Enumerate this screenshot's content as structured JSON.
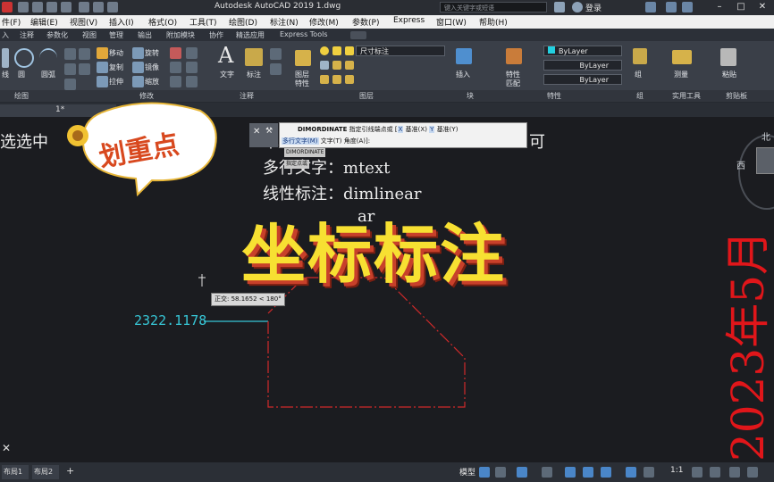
{
  "title_bar": {
    "app_title": "Autodesk AutoCAD 2019    1.dwg",
    "search_placeholder": "键入关键字或短语",
    "login": "登录"
  },
  "menu": [
    "件(F)",
    "编辑(E)",
    "视图(V)",
    "插入(I)",
    "格式(O)",
    "工具(T)",
    "绘图(D)",
    "标注(N)",
    "修改(M)",
    "参数(P)",
    "Express",
    "窗口(W)",
    "帮助(H)"
  ],
  "ribbon_tabs": [
    "入",
    "注释",
    "参数化",
    "视图",
    "管理",
    "输出",
    "附加模块",
    "协作",
    "精选应用",
    "Express Tools"
  ],
  "ribbon": {
    "draw": {
      "line": "线",
      "circle": "圆",
      "arc": "圆弧"
    },
    "modify": {
      "move": "移动",
      "rotate": "旋转",
      "copy": "复制",
      "mirror": "镜像",
      "stretch": "拉伸",
      "scale": "缩放"
    },
    "annotation": {
      "text": "文字",
      "dimension": "标注"
    },
    "layers": {
      "props": "图层",
      "props2": "特性",
      "current_layer": "尺寸标注"
    },
    "block": {
      "insert": "插入"
    },
    "properties": {
      "match": "特性",
      "match2": "匹配",
      "bylayer1": "ByLayer",
      "bylayer2": "ByLayer",
      "bylayer3": "ByLayer"
    },
    "group": {
      "group": "组"
    },
    "utilities": {
      "measure": "测量"
    },
    "clipboard": {
      "paste": "粘贴"
    },
    "panels": [
      "绘图",
      "修改",
      "注释",
      "图层",
      "块",
      "特性",
      "组",
      "实用工具",
      "剪贴板"
    ]
  },
  "doc_tab": "1*",
  "canvas": {
    "left_text": "选选中",
    "line1_prefix": "单",
    "line1_suffix": "可",
    "line2": "多行文字：mtext",
    "line3": "线性标注：dimlinear",
    "line4_tail": "ar",
    "dim_value": "2322.1178",
    "ortho_tooltip": "正交: 58.1652 < 180°",
    "dimordinate_tag": "DIMORDINATE",
    "point_tag": "指定点或",
    "compass_n": "北",
    "compass_w": "西",
    "close_x": "✕"
  },
  "command": {
    "name": "DIMORDINATE",
    "prompt": "指定引线端点或",
    "opt_x": "X",
    "opt_x_label": "基准(X)",
    "opt_y": "Y",
    "opt_y_label": "基准(Y)",
    "line2_mtext": "多行文字(M)",
    "line2_text": "文字(T)",
    "line2_angle": "角度(A)",
    "line2_end": "]:"
  },
  "layout_tabs": [
    "布局1",
    "布局2"
  ],
  "status": {
    "model": "模型",
    "scale": "1:1"
  },
  "overlay": {
    "sticker_text": "划重点",
    "big_title": "坐标标注",
    "vertical_date": "2023年5月"
  },
  "colors": {
    "dim_cyan": "#37c6d6",
    "shape_red": "#d02a2a",
    "title_yellow": "#f7e032",
    "date_red": "#e0161a"
  }
}
